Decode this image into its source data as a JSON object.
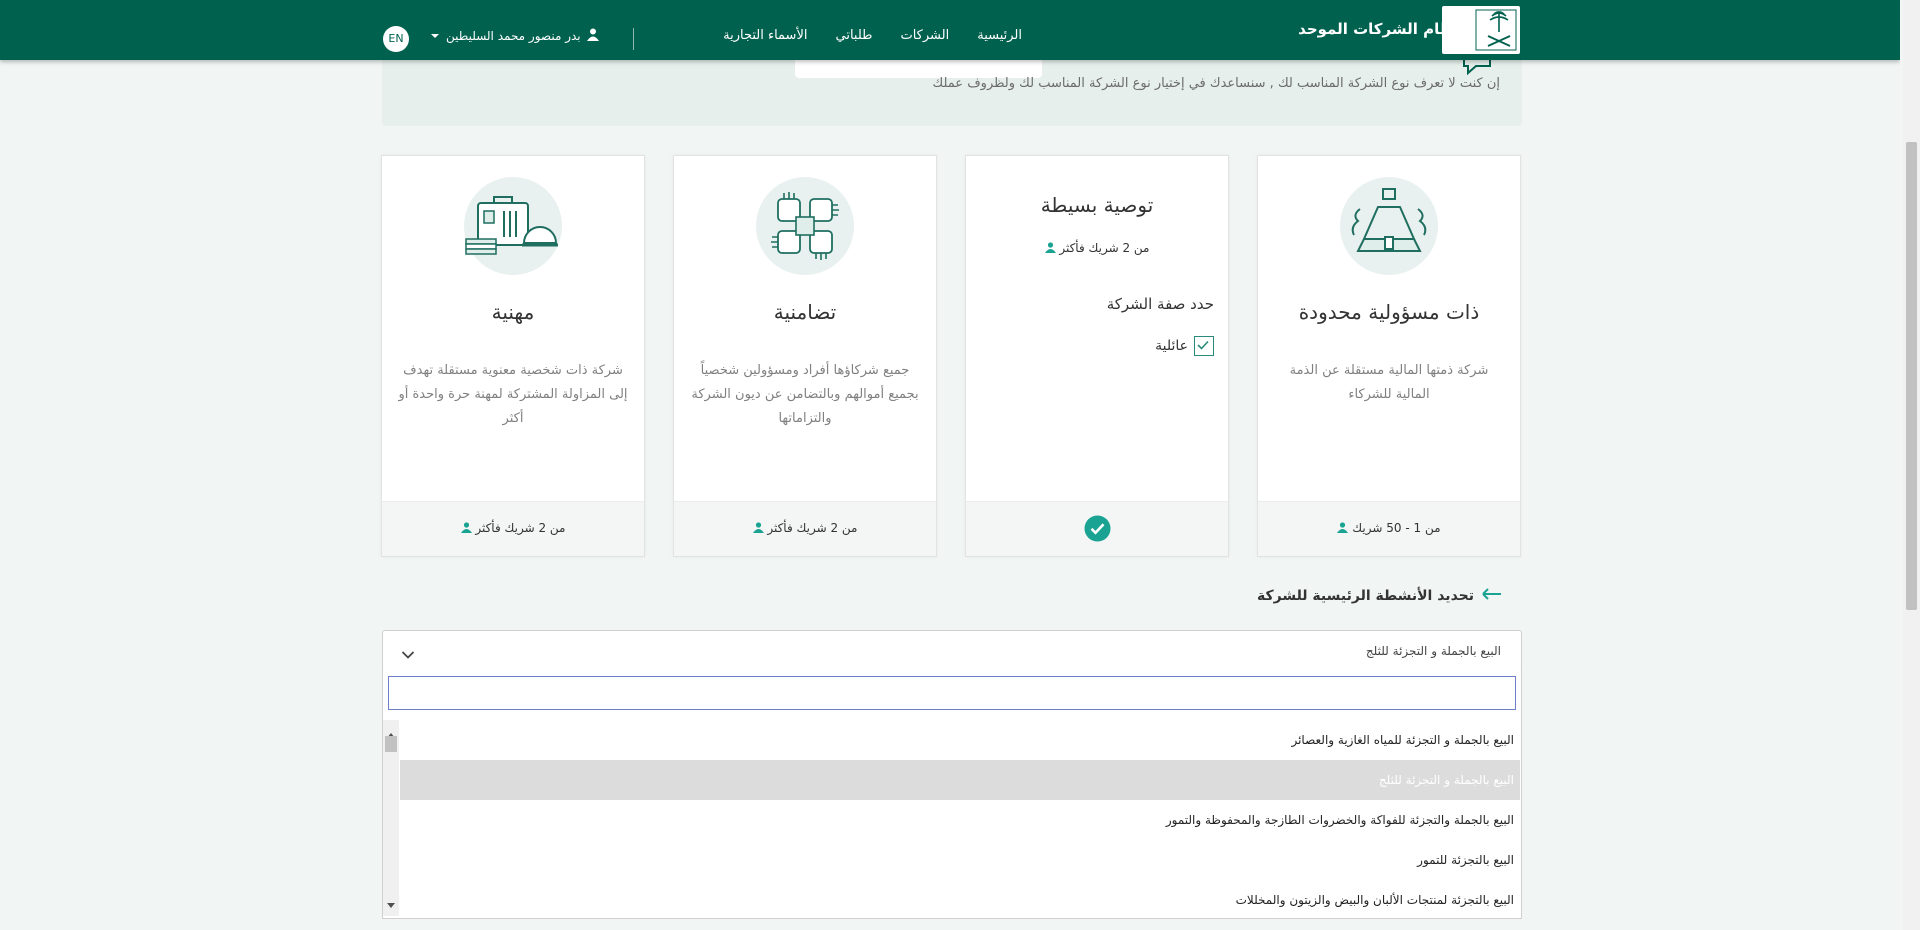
{
  "header": {
    "brand": "نظام الشركات الموحد",
    "nav": [
      "الرئيسية",
      "الشركات",
      "طلباتي",
      "الأسماء التجارية"
    ],
    "user_name": "بدر منصور محمد السليطين",
    "lang_label": "EN"
  },
  "banner": {
    "text": "إن كنت لا تعرف نوع الشركة المناسب لك , سنساعدك في إختيار نوع الشركة المناسب لك ولظروف عملك"
  },
  "cards": [
    {
      "title": "ذات مسؤولية محدودة",
      "description": "شركة ذمتها المالية مستقلة عن الذمة المالية للشركاء",
      "partners": "من 1 - 50 شريك",
      "icon": "building-icon"
    },
    {
      "title": "توصية بسيطة",
      "partners": "من 2 شريك فأكثر",
      "define_label": "حدد صفة الشركة",
      "family_label": "عائلية",
      "family_checked": true,
      "selected": true
    },
    {
      "title": "تضامنية",
      "description": "جميع شركاؤها أفراد ومسؤولين شخصياً بجميع أموالهم وبالتضامن عن ديون الشركة والتزاماتها",
      "partners": "من 2 شريك فأكثر",
      "icon": "hands-icon"
    },
    {
      "title": "مهنية",
      "description": "شركة ذات شخصية معنوية مستقلة تهدف إلى المزاولة المشتركة لمهنة حرة واحدة أو أكثر",
      "partners": "من 2 شريك فأكثر",
      "icon": "professions-icon"
    }
  ],
  "activities": {
    "heading": "تحديد الأنشطة الرئيسية للشركة",
    "selected_value": "البيع بالجملة و التجزئة للثلج",
    "search_placeholder": "",
    "options": [
      "البيع بالجملة و التجزئة للمياه الغازية والعصائر",
      "البيع بالجملة و التجزئة للثلج",
      "البيع بالجملة والتجزئة للفواكة والخضروات الطازجة والمحفوظة والتمور",
      "البيع بالتجزئة للتمور",
      "البيع بالتجزئة لمنتجات الألبان والبيض والزيتون والمخللات"
    ],
    "highlighted_index": 1
  },
  "colors": {
    "primary": "#00614f",
    "accent": "#1aa392",
    "background": "#f1f5f4"
  }
}
